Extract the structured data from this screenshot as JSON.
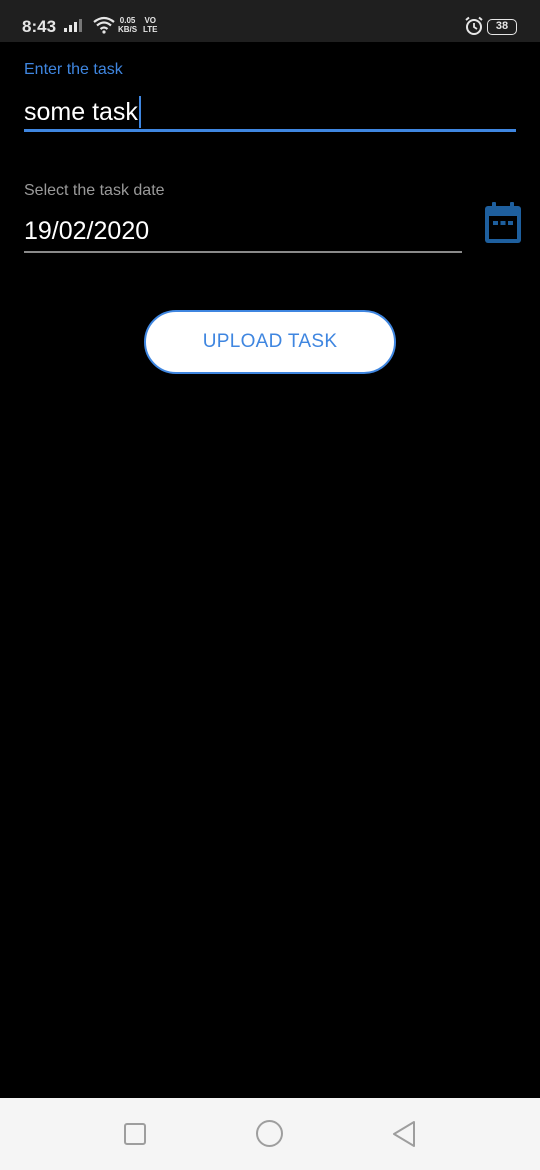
{
  "status_bar": {
    "time": "8:43",
    "net_speed_value": "0.05",
    "net_speed_unit": "KB/S",
    "volte_top": "VO",
    "volte_bottom": "LTE",
    "battery": "38"
  },
  "form": {
    "task_label": "Enter the task",
    "task_value": "some task",
    "date_label": "Select the task date",
    "date_value": "19/02/2020",
    "calendar_icon": "calendar-icon",
    "upload_button_label": "UPLOAD TASK"
  },
  "colors": {
    "accent": "#3f86e0",
    "background": "#000000",
    "calendar_icon": "#1e5f9e"
  },
  "nav_bar": {
    "recent_icon": "square-recent-apps-icon",
    "home_icon": "circle-home-icon",
    "back_icon": "triangle-back-icon"
  }
}
